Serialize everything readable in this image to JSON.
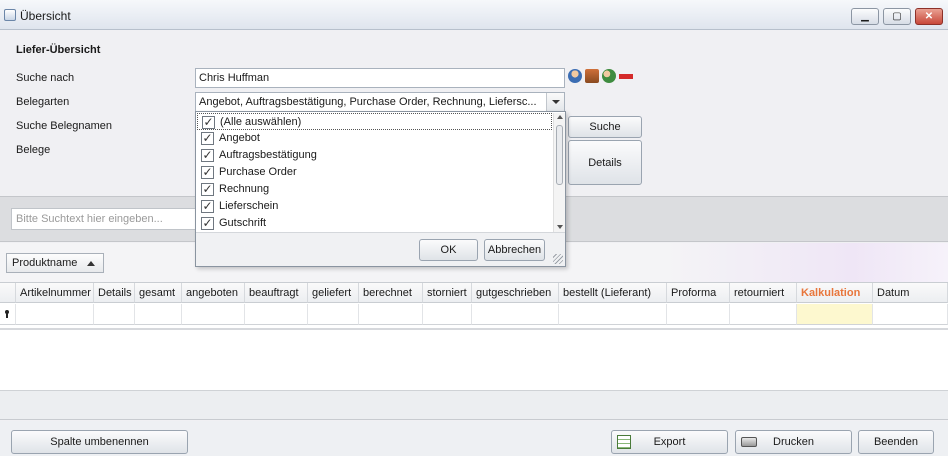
{
  "window": {
    "title": "Übersicht",
    "minimize": "▁",
    "maximize": "▢",
    "close": "✕"
  },
  "form": {
    "section_title": "Liefer-Übersicht",
    "search_by": {
      "label": "Suche nach",
      "value": "Chris Huffman"
    },
    "doc_types": {
      "label": "Belegarten",
      "value": "Angebot, Auftragsbestätigung, Purchase Order, Rechnung, Liefersc..."
    },
    "search_doc_names": {
      "label": "Suche Belegnamen"
    },
    "docs": {
      "label": "Belege"
    },
    "search_button": "Suche",
    "details_button": "Details",
    "icons": [
      "person-icon",
      "books-icon",
      "group-icon",
      "remove-icon"
    ]
  },
  "dropdown": {
    "items": [
      {
        "label": "(Alle auswählen)",
        "checked": true
      },
      {
        "label": "Angebot",
        "checked": true
      },
      {
        "label": "Auftragsbestätigung",
        "checked": true
      },
      {
        "label": "Purchase Order",
        "checked": true
      },
      {
        "label": "Rechnung",
        "checked": true
      },
      {
        "label": "Lieferschein",
        "checked": true
      },
      {
        "label": "Gutschrift",
        "checked": true
      }
    ],
    "ok": "OK",
    "cancel": "Abbrechen"
  },
  "search": {
    "placeholder": "Bitte Suchtext hier eingeben..."
  },
  "group": {
    "sort_field": "Produktname"
  },
  "grid": {
    "columns": [
      "Artikelnummer",
      "Details",
      "gesamt",
      "angeboten",
      "beauftragt",
      "geliefert",
      "berechnet",
      "storniert",
      "gutgeschrieben",
      "bestellt (Lieferant)",
      "Proforma",
      "retourniert",
      "Kalkulation",
      "Datum"
    ],
    "highlight_color": "#e8763c"
  },
  "footer": {
    "rename_column": "Spalte umbenennen",
    "export": "Export",
    "print": "Drucken",
    "close": "Beenden"
  }
}
